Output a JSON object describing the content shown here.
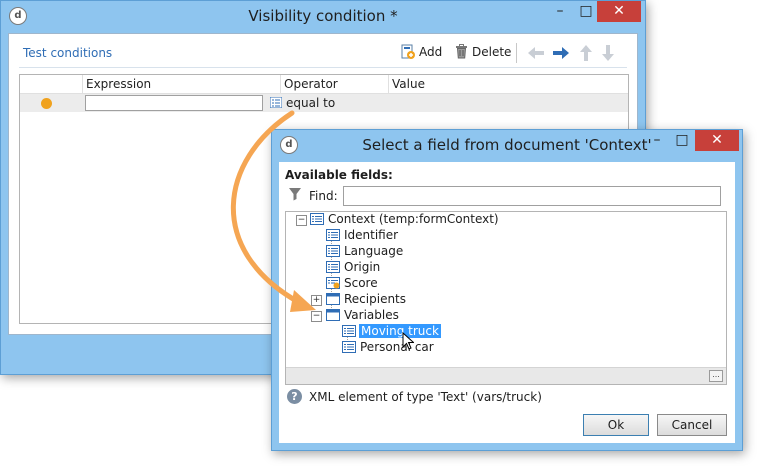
{
  "back_window": {
    "title": "Visibility condition *",
    "app_icon": "d",
    "controls": {
      "minimize": "–",
      "maximize": "□",
      "close": "✕"
    },
    "toolbar": {
      "test_conditions": "Test conditions",
      "add_label": "Add",
      "delete_label": "Delete"
    },
    "grid": {
      "columns": [
        "Expression",
        "Operator",
        "Value"
      ],
      "rows": [
        {
          "expression": "",
          "operator": "equal to",
          "value": ""
        }
      ]
    }
  },
  "dialog": {
    "title": "Select a field from document 'Context'",
    "app_icon": "d",
    "controls": {
      "minimize": "–",
      "maximize": "□",
      "close": "✕"
    },
    "available_fields_label": "Available fields:",
    "find_label": "Find:",
    "find_value": "",
    "tree": {
      "root": "Context (temp:formContext)",
      "children": [
        "Identifier",
        "Language",
        "Origin",
        "Score",
        "Recipients",
        "Variables"
      ],
      "variables_children": [
        "Moving truck",
        "Personal car"
      ],
      "selected": "Moving truck"
    },
    "more_button": "...",
    "help_text": "XML element of type 'Text' (vars/truck)",
    "ok_label": "Ok",
    "cancel_label": "Cancel"
  },
  "colors": {
    "window_frame": "#8ec5ef",
    "close_button": "#c7403a",
    "selection": "#3399ff",
    "row_marker": "#f0a21e",
    "arrow": "#f5a653",
    "link": "#2f6db5"
  }
}
